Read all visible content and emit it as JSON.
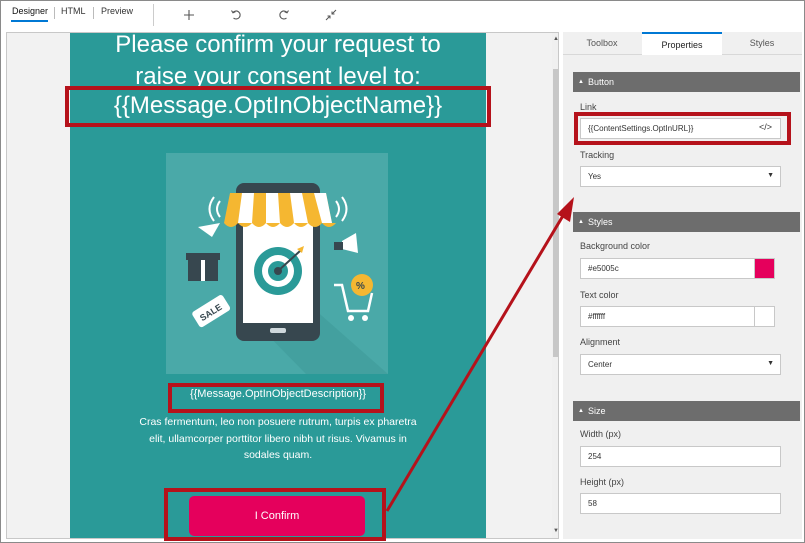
{
  "toolbar": {
    "view_tabs": [
      "Designer",
      "HTML",
      "Preview"
    ],
    "icons": [
      "add-icon",
      "undo-icon",
      "redo-icon",
      "collapse-icon"
    ]
  },
  "email": {
    "headline_line1": "Please confirm your request to",
    "headline_line2": "raise  your consent level to:",
    "headline_token": "{{Message.OptInObjectName}}",
    "image": "illustration: smartphone with shop awning, target, megaphone, gift box, sale tag, shopping cart",
    "description_token": "{{Message.OptInObjectDescription}}",
    "body_text": "Cras fermentum, leo non posuere rutrum, turpis ex pharetra elit, ullamcorper porttitor libero nibh ut risus. Vivamus in sodales quam.",
    "button_label": "I Confirm",
    "bg_color": "#2a9a98"
  },
  "panel": {
    "tabs": [
      "Toolbox",
      "Properties",
      "Styles"
    ],
    "active_tab": "Properties",
    "button_section": {
      "title": "Button",
      "link_label": "Link",
      "link_value": "{{ContentSettings.OptInURL}}",
      "tracking_label": "Tracking",
      "tracking_value": "Yes"
    },
    "styles_section": {
      "title": "Styles",
      "bg_label": "Background color",
      "bg_value": "#e5005c",
      "text_color_label": "Text color",
      "text_color_value": "#ffffff",
      "alignment_label": "Alignment",
      "alignment_value": "Center"
    },
    "size_section": {
      "title": "Size",
      "width_label": "Width (px)",
      "width_value": "254",
      "height_label": "Height (px)",
      "height_value": "58"
    }
  },
  "colors": {
    "accent": "#0078d4",
    "annotation": "#b5121b",
    "button": "#e5005c"
  }
}
